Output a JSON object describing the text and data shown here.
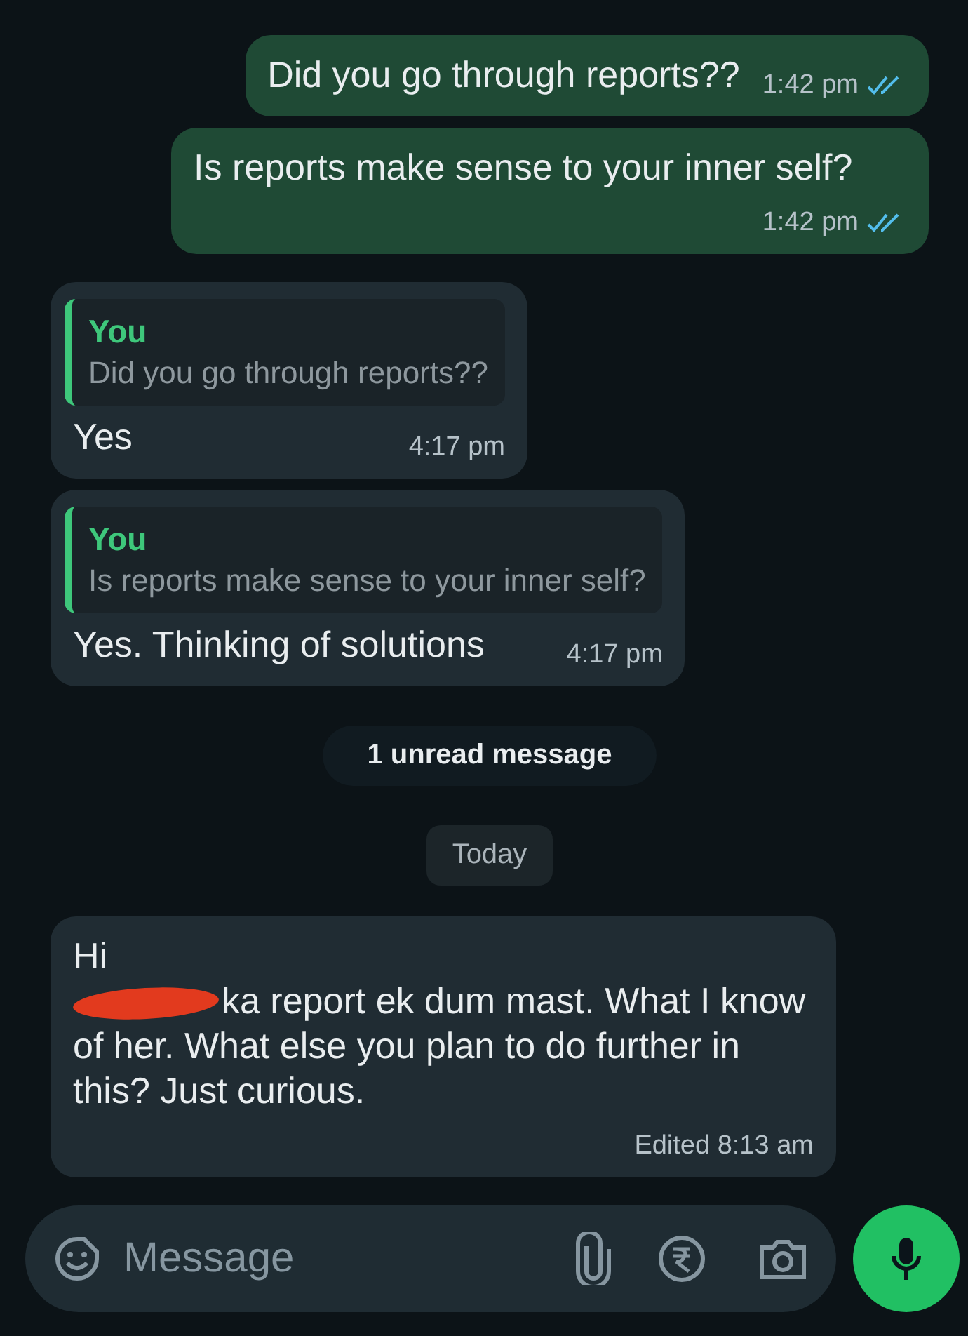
{
  "messages": [
    {
      "kind": "outgoing",
      "text": "Did you go through reports??",
      "time": "1:42 pm",
      "read": true
    },
    {
      "kind": "outgoing",
      "text": "Is reports make sense to your inner self?",
      "time": "1:42 pm",
      "read": true
    },
    {
      "kind": "incoming",
      "quote": {
        "author": "You",
        "text": "Did you go through reports??"
      },
      "text": "Yes",
      "time": "4:17 pm"
    },
    {
      "kind": "incoming",
      "quote": {
        "author": "You",
        "text": "Is reports make sense to your inner self?"
      },
      "text": "Yes. Thinking of solutions",
      "time": "4:17 pm"
    },
    {
      "kind": "unread",
      "text": "1 unread message"
    },
    {
      "kind": "date",
      "text": "Today"
    },
    {
      "kind": "incoming",
      "paragraphs": [
        {
          "text": "Hi",
          "redacted": false
        },
        {
          "text": "ka report ek dum mast. What I know of her. What else you plan to do further in this? Just curious.",
          "redacted": true
        }
      ],
      "time": "Edited 8:13 am"
    }
  ],
  "composer": {
    "placeholder": "Message"
  }
}
